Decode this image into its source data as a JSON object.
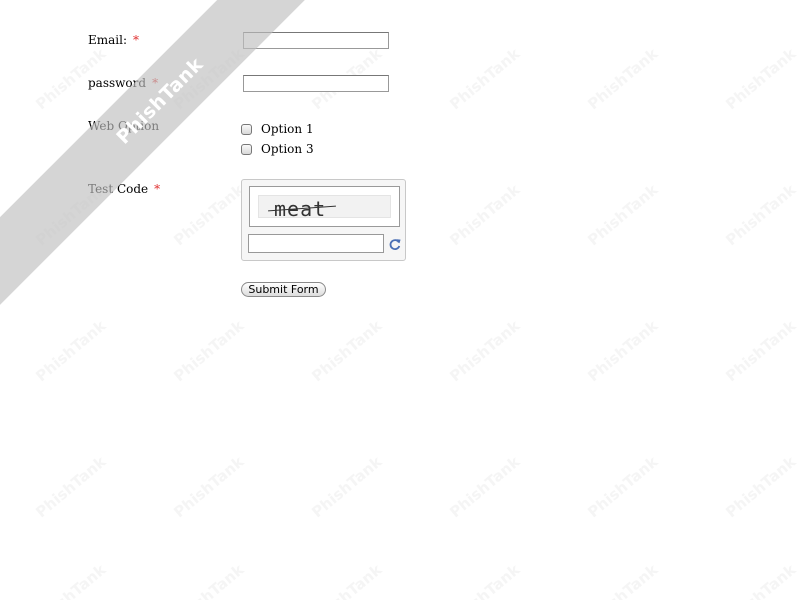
{
  "watermark": {
    "text": "PhishTank",
    "ribbon_text": "PhishTank"
  },
  "form": {
    "email": {
      "label": "Email:",
      "required_mark": "*",
      "value": ""
    },
    "password": {
      "label": "password",
      "required_mark": "*",
      "value": ""
    },
    "web_option": {
      "label": "Web Option",
      "options": [
        {
          "label": "Option 1",
          "checked": false
        },
        {
          "label": "Option 3",
          "checked": false
        }
      ]
    },
    "test_code": {
      "label": "Test Code",
      "required_mark": "*",
      "captcha_word": "meat",
      "value": "",
      "refresh_icon": "refresh-icon"
    },
    "submit_label": "Submit Form"
  },
  "colors": {
    "required": "#e03030",
    "ribbon": "#bebebe"
  }
}
